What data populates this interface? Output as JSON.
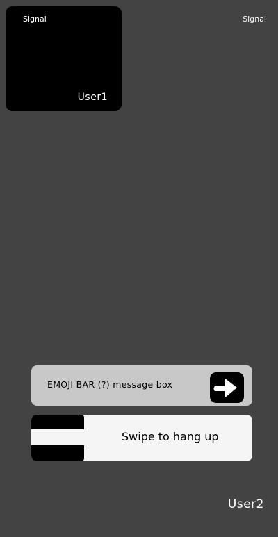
{
  "self_view": {
    "signal_label": "Signal",
    "user_name": "User1"
  },
  "remote_view": {
    "signal_label": "Signal",
    "user_name": "User2"
  },
  "message_bar": {
    "text": "EMOJI BAR (?) message box",
    "send_icon": "arrow-right-icon"
  },
  "hangup": {
    "label": "Swipe to hang up"
  },
  "colors": {
    "background": "#434343",
    "self_view": "#000000",
    "message_box": "#c8c8c8",
    "hangup_bar": "#f5f5f5",
    "text_light": "#ffffff"
  }
}
